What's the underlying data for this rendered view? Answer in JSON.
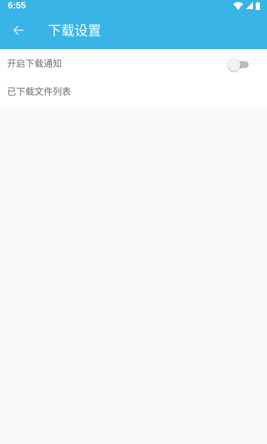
{
  "status_bar": {
    "time": "6:55",
    "icons": [
      "wifi-icon",
      "cell-signal-icon",
      "battery-icon"
    ]
  },
  "app_bar": {
    "back_icon": "arrow-left-icon",
    "title": "下载设置"
  },
  "settings": {
    "items": [
      {
        "label": "开启下载通知",
        "control": "toggle",
        "checked": false
      },
      {
        "label": "已下载文件列表",
        "control": "none"
      }
    ]
  },
  "colors": {
    "accent": "#38b4e6",
    "background": "#fafafa",
    "label_text": "#6e6e6e"
  }
}
